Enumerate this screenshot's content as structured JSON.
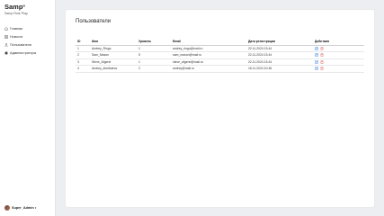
{
  "sidebar": {
    "brand": {
      "title": "Samp",
      "sup": "®",
      "subtitle": "Samp Role Play"
    },
    "items": [
      {
        "label": "Главная",
        "icon": "home-icon"
      },
      {
        "label": "Новости",
        "icon": "news-icon"
      },
      {
        "label": "Пользователи",
        "icon": "users-icon"
      },
      {
        "label": "Администраторы",
        "icon": "admin-icon"
      }
    ],
    "user": {
      "name": "Super_Admin"
    }
  },
  "main": {
    "title": "Пользователи",
    "table": {
      "headers": [
        "ID",
        "Имя",
        "Уровень",
        "Email",
        "Дата регистрации",
        "Действия"
      ],
      "rows": [
        {
          "id": "1",
          "name": "Andrey_Ringo",
          "level": "1",
          "email": "andrey_ringo@mail.ru",
          "date": "22.11.2024 13:44",
          "highlight": false
        },
        {
          "id": "2",
          "name": "Sam_Mason",
          "level": "5",
          "email": "sam_mason@mail.ru",
          "date": "22.11.2024 13:44",
          "highlight": true
        },
        {
          "id": "3",
          "name": "Steve_Afgerel",
          "level": "1",
          "email": "steve_afgerel@mail.ru",
          "date": "22.11.2024 13:44",
          "highlight": false
        },
        {
          "id": "4",
          "name": "Andrey_sherbakov",
          "level": "2",
          "email": "andrey@mail.ru",
          "date": "16.11.2024 10:46",
          "highlight": false
        }
      ]
    }
  },
  "colors": {
    "edit": "#2b7bd6",
    "delete": "#d9534f",
    "email_highlight": "#d9534f"
  }
}
